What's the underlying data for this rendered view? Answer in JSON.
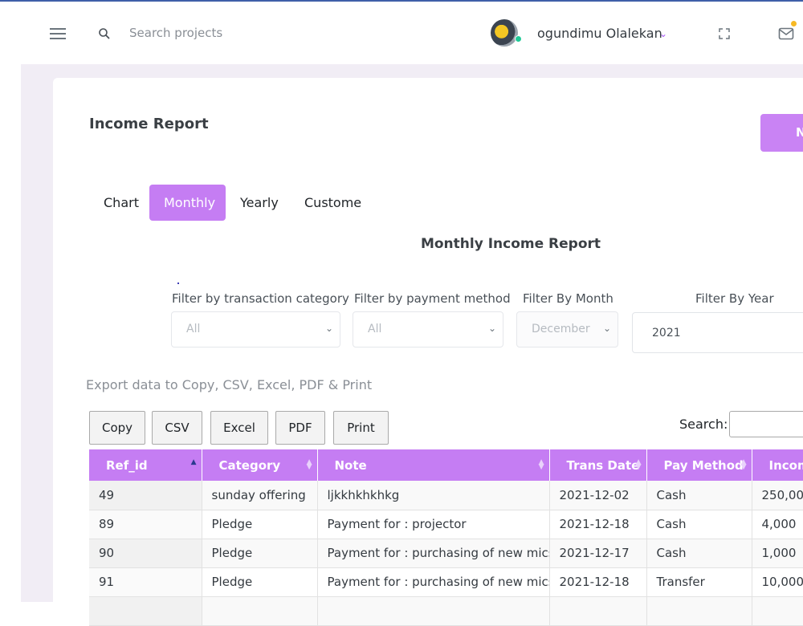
{
  "topbar": {
    "search_placeholder": "Search projects",
    "user_name": "ogundimu Olalekan"
  },
  "card": {
    "title": "Income Report",
    "new_button_label": "N"
  },
  "tabs": [
    {
      "label": "Chart",
      "active": false
    },
    {
      "label": "Monthly",
      "active": true
    },
    {
      "label": "Yearly",
      "active": false
    },
    {
      "label": "Custome",
      "active": false
    }
  ],
  "report_title": "Monthly Income Report",
  "filters": {
    "category": {
      "label": "Filter by transaction category",
      "value": "All"
    },
    "payment": {
      "label": "Filter by payment method",
      "value": "All"
    },
    "month": {
      "label": "Filter By Month",
      "value": "December"
    },
    "year": {
      "label": "Filter By Year",
      "value": "2021"
    }
  },
  "export": {
    "text": "Export data to Copy, CSV, Excel, PDF & Print",
    "buttons": [
      "Copy",
      "CSV",
      "Excel",
      "PDF",
      "Print"
    ]
  },
  "datatable": {
    "search_label": "Search:",
    "columns": [
      "Ref_id",
      "Category",
      "Note",
      "Trans Date",
      "Pay Method",
      "Incom"
    ],
    "rows": [
      [
        "49",
        "sunday offering",
        "ljkkhkhkhkg",
        "2021-12-02",
        "Cash",
        "250,000"
      ],
      [
        "89",
        "Pledge",
        "Payment for : projector",
        "2021-12-18",
        "Cash",
        "4,000"
      ],
      [
        "90",
        "Pledge",
        "Payment for : purchasing of new mics",
        "2021-12-17",
        "Cash",
        "1,000"
      ],
      [
        "91",
        "Pledge",
        "Payment for : purchasing of new mics",
        "2021-12-18",
        "Transfer",
        "10,000"
      ],
      [
        "",
        "",
        "",
        "",
        "",
        ""
      ]
    ]
  },
  "colors": {
    "accent": "#c57df3",
    "header_text": "#ffffff",
    "page_background": "#f1edf5"
  }
}
